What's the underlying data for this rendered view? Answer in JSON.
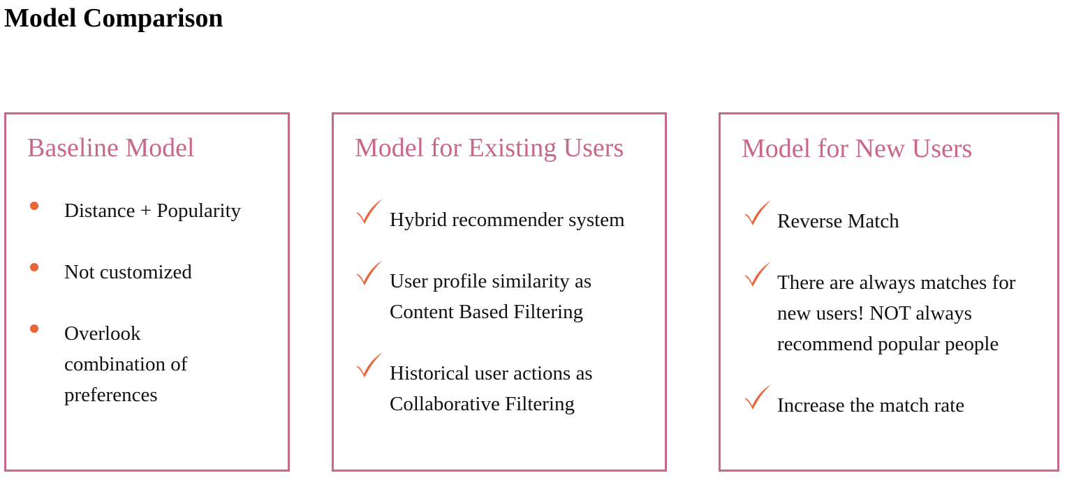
{
  "page": {
    "title": "Model Comparison"
  },
  "colors": {
    "panel_border": "#c9678a",
    "panel_title": "#c9678a",
    "marker": "#e8643a"
  },
  "panels": [
    {
      "title": "Baseline Model",
      "marker_icon": "bullet-dot-icon",
      "items": [
        {
          "text": "Distance +  Popularity"
        },
        {
          "text": "Not customized"
        },
        {
          "text": "Overlook combination of preferences"
        }
      ]
    },
    {
      "title": "Model for Existing Users",
      "marker_icon": "checkmark-icon",
      "items": [
        {
          "text": "Hybrid recommender system"
        },
        {
          "text": "User profile similarity as Content Based Filtering"
        },
        {
          "text": "Historical user actions as Collaborative Filtering"
        }
      ]
    },
    {
      "title": "Model for New Users",
      "marker_icon": "checkmark-icon",
      "items": [
        {
          "text": "Reverse Match"
        },
        {
          "text": "There are always matches for new users!  NOT always recommend popular people"
        },
        {
          "text": "Increase the match rate"
        }
      ]
    }
  ]
}
